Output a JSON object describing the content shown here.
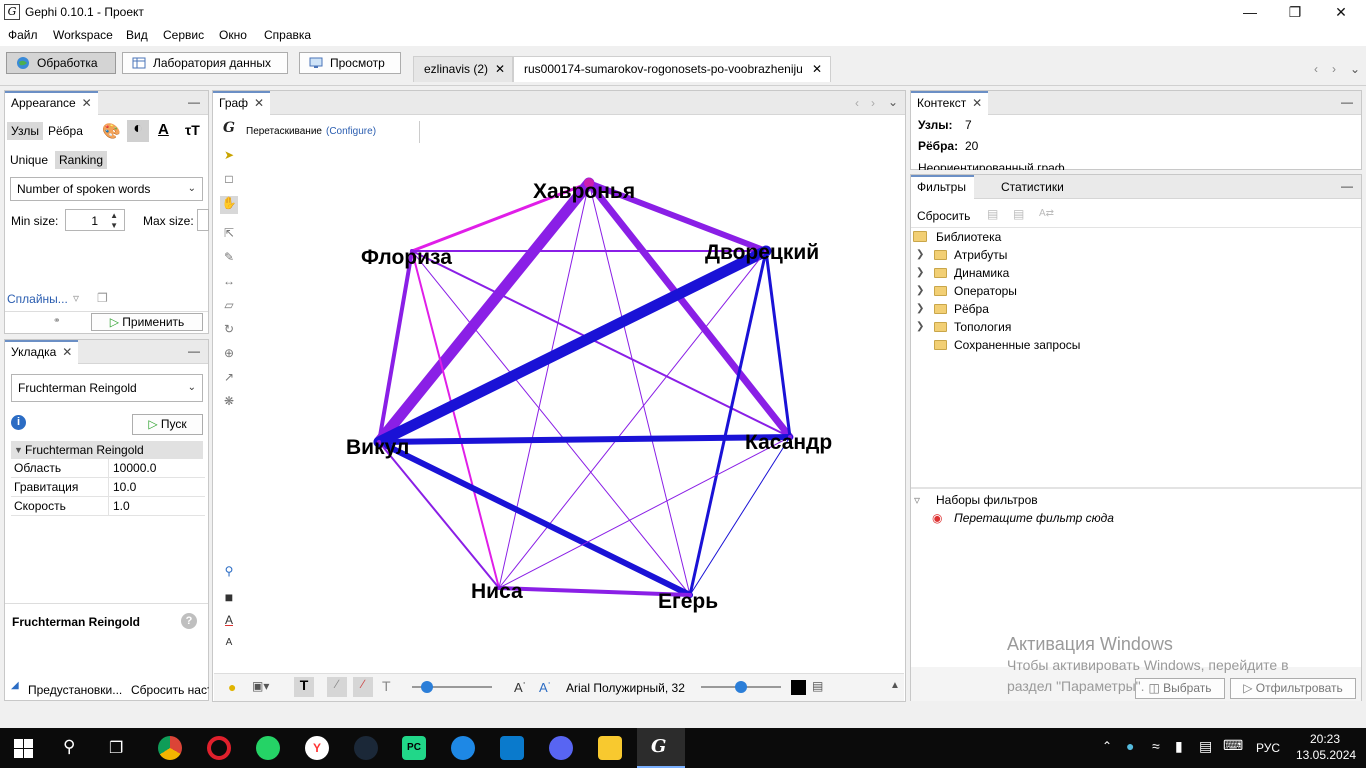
{
  "window": {
    "title": "Gephi 0.10.1 - Проект",
    "controls": [
      "minimize",
      "maximize",
      "close"
    ]
  },
  "menu": [
    "Файл",
    "Workspace",
    "Вид",
    "Сервис",
    "Окно",
    "Справка"
  ],
  "modes": {
    "overview": "Обработка",
    "data_lab": "Лаборатория данных",
    "preview": "Просмотр"
  },
  "doc_tabs": [
    {
      "label": "ezlinavis (2)"
    },
    {
      "label": "rus000174-sumarokov-rogonosets-po-voobrazheniju"
    }
  ],
  "appearance": {
    "title": "Appearance",
    "tab_nodes": "Узлы",
    "tab_edges": "Рёбра",
    "sub_unique": "Unique",
    "sub_ranking": "Ranking",
    "attribute": "Number of spoken words",
    "min_size_label": "Min size:",
    "min_size_value": "1",
    "max_size_label": "Max size:",
    "splines": "Сплайны...",
    "apply": "Применить"
  },
  "layout": {
    "title": "Укладка",
    "algorithm": "Fruchterman Reingold",
    "run": "Пуск",
    "section": "Fruchterman Reingold",
    "props": [
      {
        "key": "Область",
        "value": "10000.0"
      },
      {
        "key": "Гравитация",
        "value": "10.0"
      },
      {
        "key": "Скорость",
        "value": "1.0"
      }
    ],
    "desc_title": "Fruchterman Reingold",
    "presets": "Предустановки...",
    "reset": "Сбросить наст"
  },
  "graph": {
    "tab": "Граф",
    "drag_label": "Перетаскивание",
    "configure": "(Configure)",
    "font_label": "Arial Полужирный, 32",
    "nodes": [
      {
        "label": "Хавронья"
      },
      {
        "label": "Дворецкий"
      },
      {
        "label": "Касандр"
      },
      {
        "label": "Егерь"
      },
      {
        "label": "Ниса"
      },
      {
        "label": "Викул"
      },
      {
        "label": "Флориза"
      }
    ]
  },
  "context": {
    "title": "Контекст",
    "nodes_label": "Узлы:",
    "nodes_value": "7",
    "edges_label": "Рёбра:",
    "edges_value": "20",
    "type": "Неориентированный граф"
  },
  "filters": {
    "tab_filters": "Фильтры",
    "tab_stats": "Статистики",
    "reset": "Сбросить",
    "library": "Библиотека",
    "items": [
      "Атрибуты",
      "Динамика",
      "Операторы",
      "Рёбра",
      "Топология",
      "Сохраненные запросы"
    ],
    "sets": "Наборы фильтров",
    "drop_hint": "Перетащите фильтр сюда",
    "select": "Выбрать",
    "filter": "Отфильтровать"
  },
  "watermark": {
    "line1": "Активация Windows",
    "line2": "Чтобы активировать Windows, перейдите в",
    "line3": "раздел \"Параметры\"."
  },
  "taskbar": {
    "lang": "РУС",
    "time": "20:23",
    "date": "13.05.2024"
  },
  "colors": {
    "accent": "#6b8fc5",
    "edge_purple": "#8a1fe6",
    "edge_blue": "#1a12d6",
    "edge_magenta": "#e01ee8"
  }
}
